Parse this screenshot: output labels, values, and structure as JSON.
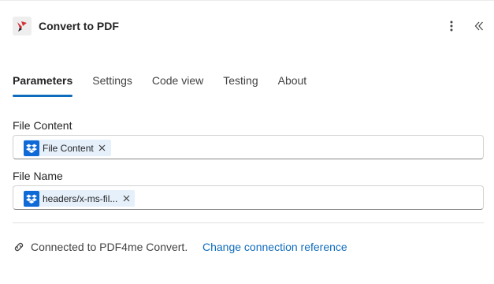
{
  "header": {
    "title": "Convert to PDF",
    "app_icon": "pdf4me-logo-icon",
    "more_icon": "more-vertical-icon",
    "collapse_icon": "chevron-double-left-icon"
  },
  "tabs": [
    {
      "label": "Parameters",
      "active": true
    },
    {
      "label": "Settings",
      "active": false
    },
    {
      "label": "Code view",
      "active": false
    },
    {
      "label": "Testing",
      "active": false
    },
    {
      "label": "About",
      "active": false
    }
  ],
  "fields": {
    "file_content": {
      "label": "File Content",
      "token": {
        "text": "File Content",
        "icon": "dropbox-icon"
      }
    },
    "file_name": {
      "label": "File Name",
      "token": {
        "text": "headers/x-ms-fil...",
        "icon": "dropbox-icon"
      }
    }
  },
  "connection": {
    "icon": "link-icon",
    "text": "Connected to PDF4me Convert.",
    "link": "Change connection reference"
  },
  "colors": {
    "accent": "#0f6cbd",
    "dropbox_blue": "#0f6ad7",
    "token_bg": "#e6f0fa",
    "logo_red": "#d13438"
  }
}
